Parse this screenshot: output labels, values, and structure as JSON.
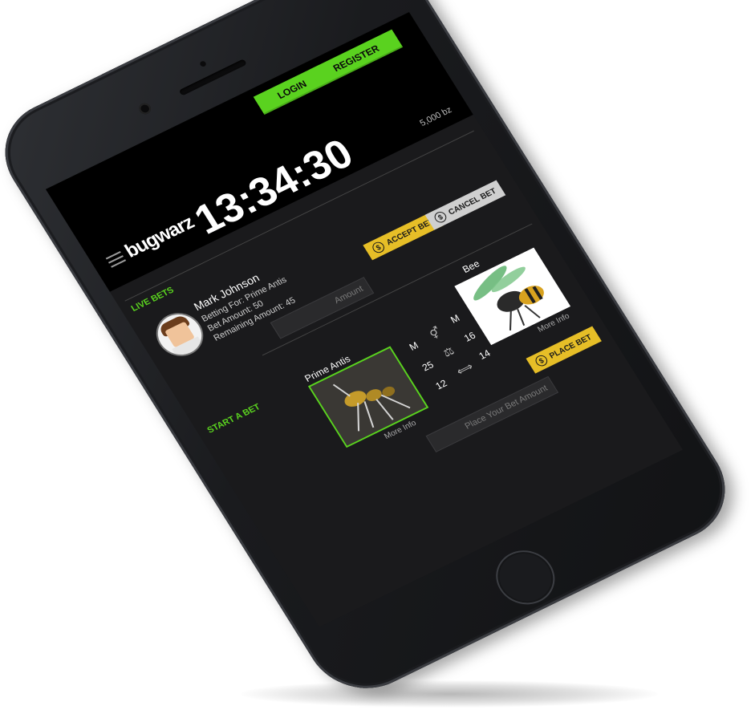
{
  "brand": {
    "logo": "bugwarz"
  },
  "header": {
    "login_label": "LOGIN",
    "register_label": "REGISTER",
    "timer": "13:34:30",
    "balance": "5,000 bz"
  },
  "live_bets": {
    "section_label": "LIVE BETS",
    "bettor": {
      "name": "Mark Johnson",
      "betting_for": "Betting For: Prime Antis",
      "bet_amount": "Bet Amount: 50",
      "remaining_amount": "Remaining Amount: 45"
    },
    "accept_label": "ACCEPT BET",
    "cancel_label": "CANCEL BET",
    "amount_placeholder": "Amount"
  },
  "start_bet": {
    "section_label": "START A BET",
    "left_bug": {
      "name": "Prime Antis",
      "more_info": "More Info"
    },
    "right_bug": {
      "name": "Bee",
      "more_info": "More Info"
    },
    "stats": {
      "gender_left": "M",
      "gender_right": "M",
      "weight_left": "25",
      "weight_right": "16",
      "size_left": "12",
      "size_right": "14"
    },
    "place_label": "PLACE BET",
    "amount_placeholder": "Place Your Bet Amount"
  },
  "icons": {
    "menu": "hamburger-icon",
    "coin": "coin-icon",
    "gender": "gender-icon",
    "scale": "scale-icon",
    "size": "size-arrows-icon"
  },
  "colors": {
    "accent_green": "#5ad21f",
    "accent_yellow": "#e6be27",
    "screen_bg": "#1a1a1c"
  }
}
